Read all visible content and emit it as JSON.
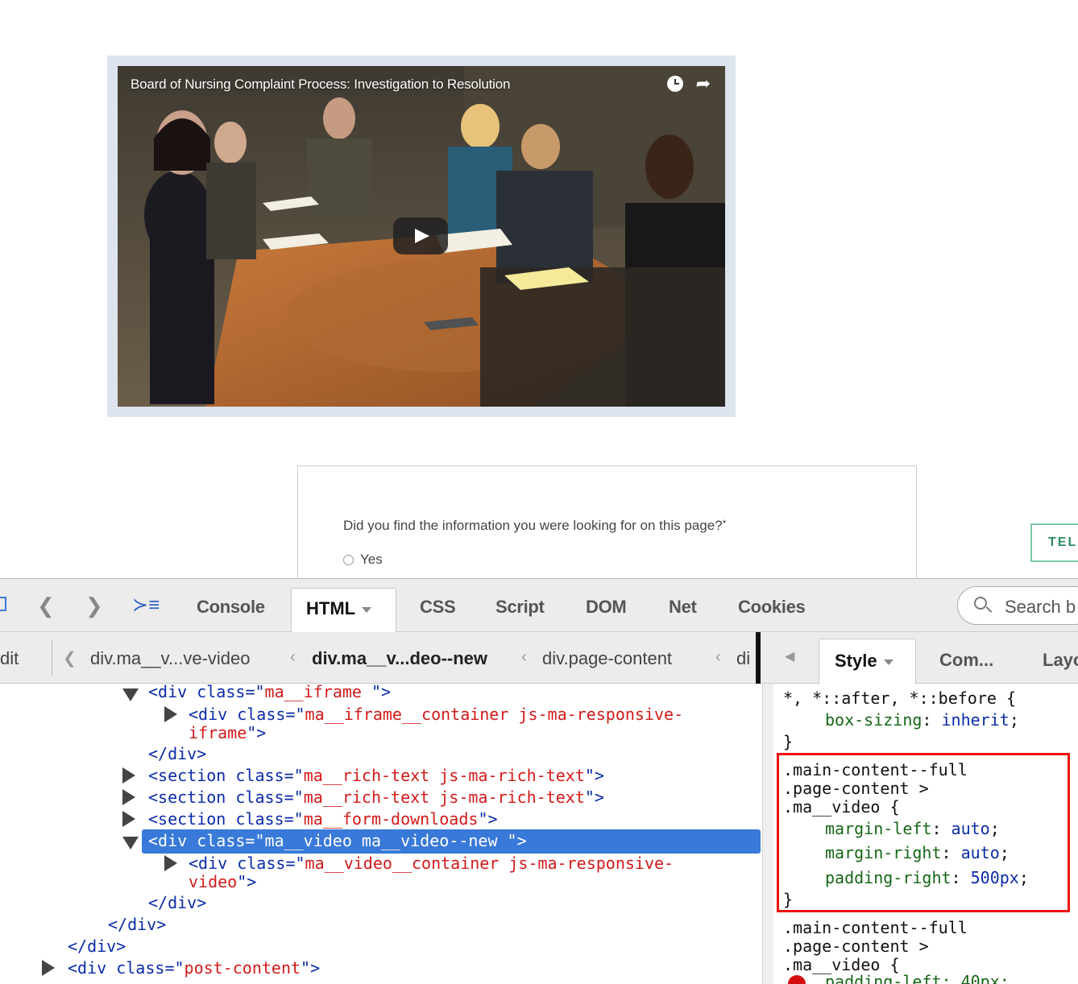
{
  "video": {
    "title": "Board of Nursing Complaint Process: Investigation to Resolution"
  },
  "feedback": {
    "question": "Did you find the information you were looking for on this page?",
    "required_mark": "*",
    "option_yes": "Yes"
  },
  "tell_button": "TEL",
  "devtools": {
    "tabs": [
      "Console",
      "HTML",
      "CSS",
      "Script",
      "DOM",
      "Net",
      "Cookies"
    ],
    "active_tab": "HTML",
    "search_placeholder": "Search b",
    "breadcrumbs": {
      "edit": "dit",
      "crumb1": "div.ma__v...ve-video",
      "crumb2": "div.ma__v...deo--new",
      "crumb3": "div.page-content",
      "crumb4": "di"
    },
    "side_tabs": {
      "style": "Style",
      "computed": "Com...",
      "layout": "Layo"
    },
    "tree": [
      {
        "indent": "ma__iframe",
        "open": true
      },
      {
        "text": "ma__iframe__container js-ma-responsive-"
      },
      {
        "text": "iframe"
      },
      {
        "text": "ma__rich-text js-ma-rich-text"
      },
      {
        "text": "ma__form-downloads"
      },
      {
        "text": "ma__video ma__video--new "
      },
      {
        "text": "ma__video__container js-ma-responsive-"
      },
      {
        "text": "video"
      },
      {
        "text": "post-content"
      }
    ],
    "css_rules": {
      "rule1_selector": "*, *::after, *::before {",
      "rule1_prop": "box-sizing",
      "rule1_val": "inherit",
      "rule2_sel1": ".main-content--full",
      "rule2_sel2": ".page-content >",
      "rule2_sel3": ".ma__video {",
      "rule2_props": [
        {
          "prop": "margin-left",
          "val": "auto"
        },
        {
          "prop": "margin-right",
          "val": "auto"
        },
        {
          "prop": "padding-right",
          "val": "500px"
        }
      ],
      "rule3_sel1": ".main-content--full",
      "rule3_sel2": ".page-content >",
      "rule3_sel3": ".ma__video {",
      "rule3_partial": "padding-left: 40px;"
    }
  }
}
